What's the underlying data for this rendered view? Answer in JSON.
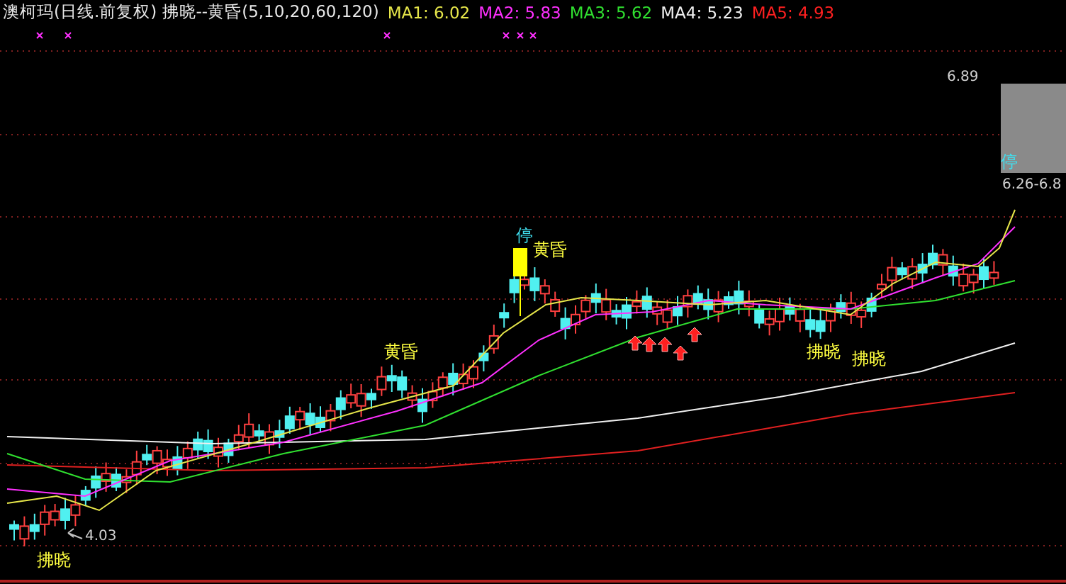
{
  "header": {
    "title": "澳柯玛(日线.前复权) 拂晓--黄昏(5,10,20,60,120)",
    "legend": [
      {
        "text": "MA1: 6.02",
        "color": "#e6e64a"
      },
      {
        "text": "MA2: 5.83",
        "color": "#ff30ff"
      },
      {
        "text": "MA3: 5.62",
        "color": "#30e030"
      },
      {
        "text": "MA4: 5.23",
        "color": "#f0f0f0"
      },
      {
        "text": "MA5: 4.93",
        "color": "#ff2020"
      }
    ]
  },
  "annotations": [
    {
      "kind": "limit",
      "text": "停"
    },
    {
      "kind": "signal",
      "text": "黄昏"
    },
    {
      "kind": "signal",
      "text": "黄昏"
    },
    {
      "kind": "signal",
      "text": "拂晓"
    },
    {
      "kind": "signal",
      "text": "拂晓"
    },
    {
      "kind": "signal",
      "text": "拂晓"
    },
    {
      "kind": "price",
      "text": "4.03"
    },
    {
      "kind": "price",
      "text": "6.89"
    },
    {
      "kind": "limit",
      "text": "停"
    },
    {
      "kind": "price",
      "text": "6.26-6.8"
    }
  ]
}
